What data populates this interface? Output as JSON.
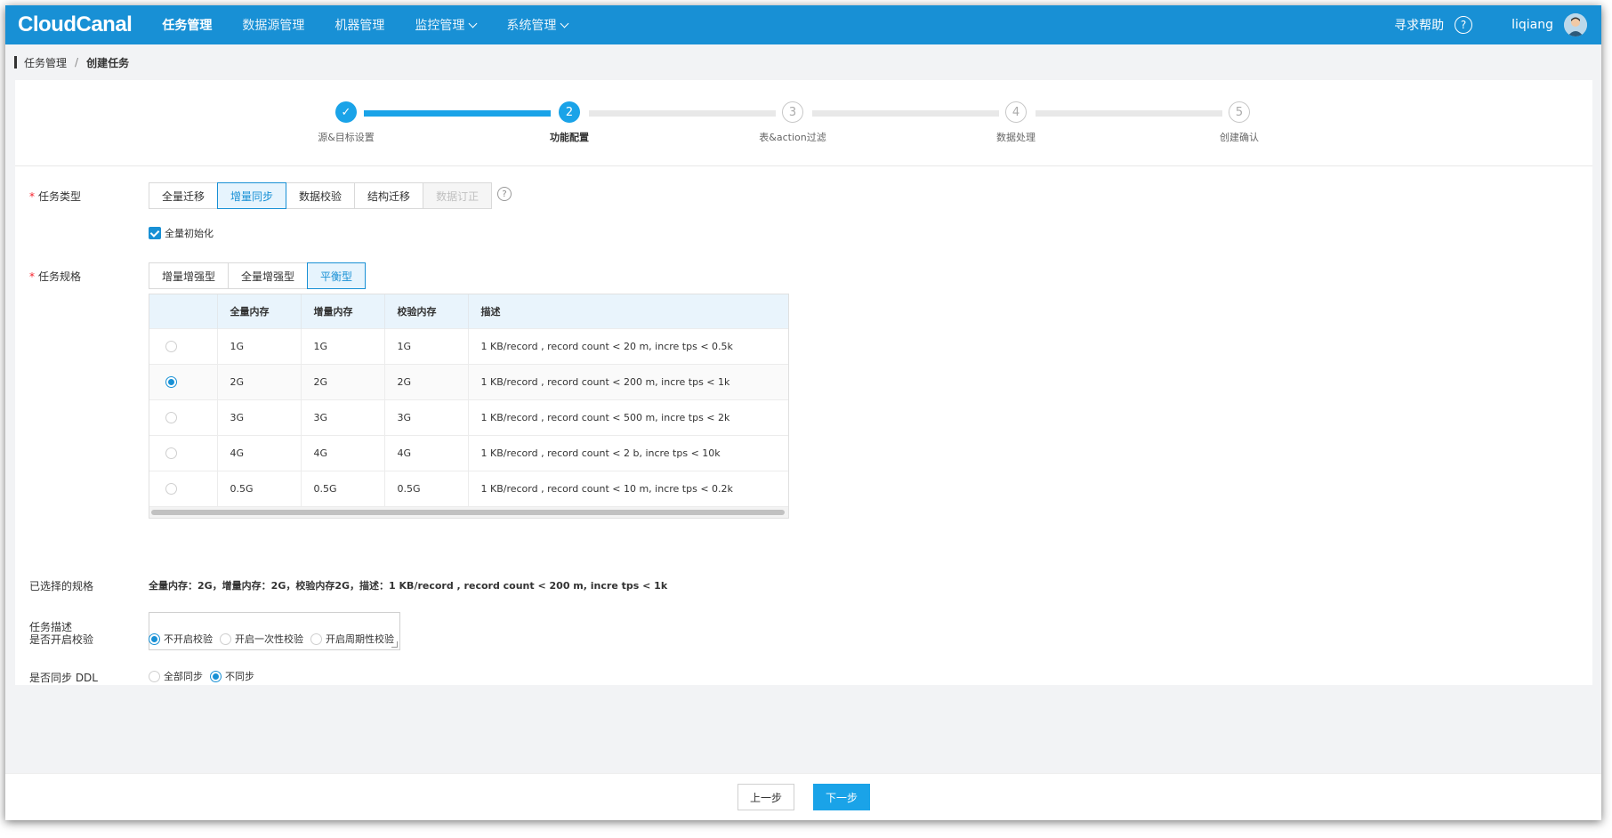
{
  "app": {
    "logo": "CloudCanal"
  },
  "nav": {
    "items": [
      {
        "label": "任务管理",
        "active": true,
        "dropdown": false
      },
      {
        "label": "数据源管理",
        "active": false,
        "dropdown": false
      },
      {
        "label": "机器管理",
        "active": false,
        "dropdown": false
      },
      {
        "label": "监控管理",
        "active": false,
        "dropdown": true
      },
      {
        "label": "系统管理",
        "active": false,
        "dropdown": true
      }
    ],
    "help_label": "寻求帮助",
    "help_icon": "?",
    "username": "liqiang"
  },
  "breadcrumb": {
    "parent": "任务管理",
    "separator": "/",
    "current": "创建任务"
  },
  "steps": [
    {
      "index": "✓",
      "label": "源&目标设置",
      "state": "done"
    },
    {
      "index": "2",
      "label": "功能配置",
      "state": "active"
    },
    {
      "index": "3",
      "label": "表&action过滤",
      "state": "todo"
    },
    {
      "index": "4",
      "label": "数据处理",
      "state": "todo"
    },
    {
      "index": "5",
      "label": "创建确认",
      "state": "todo"
    }
  ],
  "task_type": {
    "label": "任务类型",
    "required_mark": "*",
    "options": [
      {
        "label": "全量迁移",
        "state": "normal"
      },
      {
        "label": "增量同步",
        "state": "selected"
      },
      {
        "label": "数据校验",
        "state": "normal"
      },
      {
        "label": "结构迁移",
        "state": "normal"
      },
      {
        "label": "数据订正",
        "state": "disabled"
      }
    ],
    "help_icon": "?"
  },
  "full_init": {
    "label": "全量初始化",
    "checked": true
  },
  "task_spec": {
    "label": "任务规格",
    "required_mark": "*",
    "options": [
      {
        "label": "增量增强型",
        "state": "normal"
      },
      {
        "label": "全量增强型",
        "state": "normal"
      },
      {
        "label": "平衡型",
        "state": "selected"
      }
    ],
    "table": {
      "headers": [
        "",
        "全量内存",
        "增量内存",
        "校验内存",
        "描述"
      ],
      "rows": [
        {
          "selected": false,
          "full": "1G",
          "incr": "1G",
          "check": "1G",
          "desc": "1 KB/record , record count < 20 m, incre tps < 0.5k"
        },
        {
          "selected": true,
          "full": "2G",
          "incr": "2G",
          "check": "2G",
          "desc": "1 KB/record , record count < 200 m, incre tps < 1k"
        },
        {
          "selected": false,
          "full": "3G",
          "incr": "3G",
          "check": "3G",
          "desc": "1 KB/record , record count < 500 m, incre tps < 2k"
        },
        {
          "selected": false,
          "full": "4G",
          "incr": "4G",
          "check": "4G",
          "desc": "1 KB/record , record count < 2 b, incre tps < 10k"
        },
        {
          "selected": false,
          "full": "0.5G",
          "incr": "0.5G",
          "check": "0.5G",
          "desc": "1 KB/record , record count < 10 m, incre tps < 0.2k"
        }
      ]
    }
  },
  "selected_spec": {
    "label": "已选择的规格",
    "value": "全量内存：2G，增量内存：2G，校验内存2G，描述：1 KB/record , record count < 200 m, incre tps < 1k"
  },
  "task_desc": {
    "label": "任务描述",
    "value": ""
  },
  "sync_ddl": {
    "label": "是否同步 DDL",
    "options": [
      {
        "label": "全部同步",
        "selected": false
      },
      {
        "label": "不同步",
        "selected": true
      }
    ]
  },
  "enable_check": {
    "label": "是否开启校验",
    "options": [
      {
        "label": "不开启校验",
        "selected": true
      },
      {
        "label": "开启一次性校验",
        "selected": false
      },
      {
        "label": "开启周期性校验",
        "selected": false
      }
    ]
  },
  "footer": {
    "prev_label": "上一步",
    "next_label": "下一步"
  },
  "colors": {
    "primary": "#1890d5",
    "step_active": "#1aa3e8",
    "required": "#f5222d"
  }
}
